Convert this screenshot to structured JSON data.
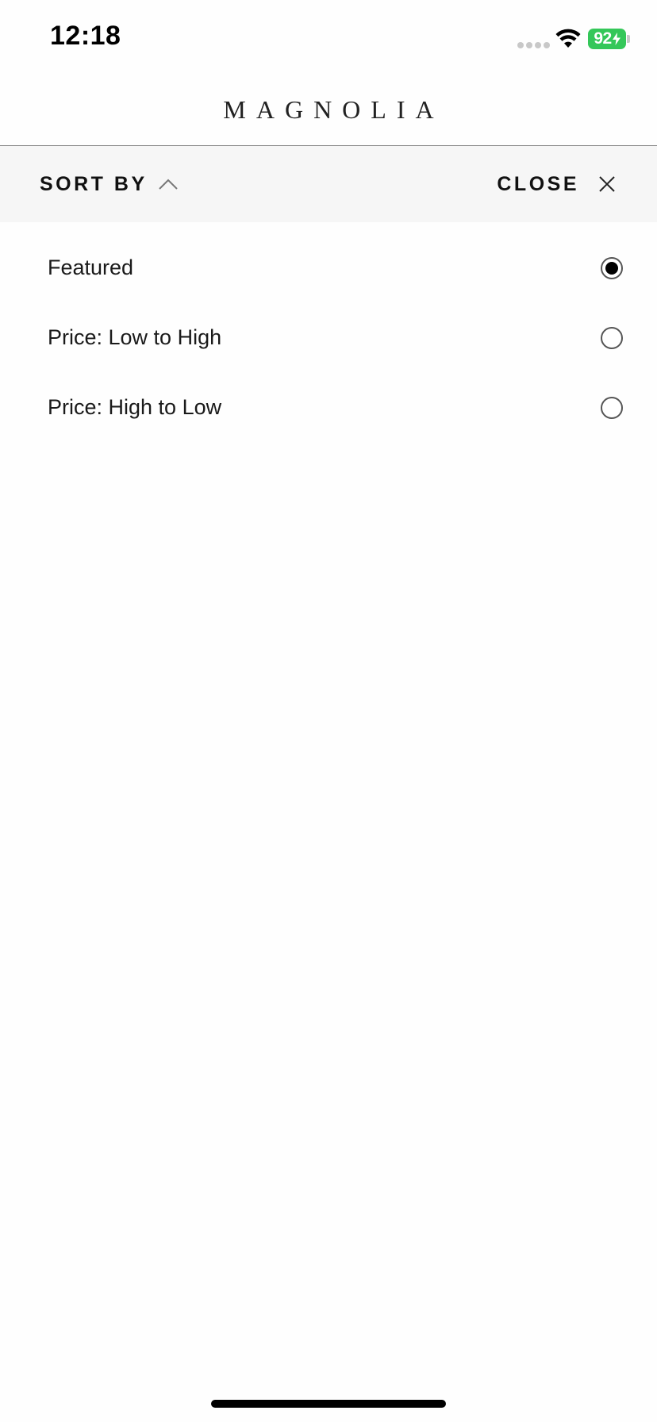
{
  "status_bar": {
    "time": "12:18",
    "battery_level": "92"
  },
  "header": {
    "brand": "MAGNOLIA"
  },
  "sort_bar": {
    "sort_label": "SORT BY",
    "close_label": "CLOSE"
  },
  "sort_options": [
    {
      "label": "Featured",
      "selected": true
    },
    {
      "label": "Price: Low to High",
      "selected": false
    },
    {
      "label": "Price: High to Low",
      "selected": false
    }
  ],
  "colors": {
    "battery": "#34c759",
    "sort_bar_bg": "#f6f6f6"
  }
}
